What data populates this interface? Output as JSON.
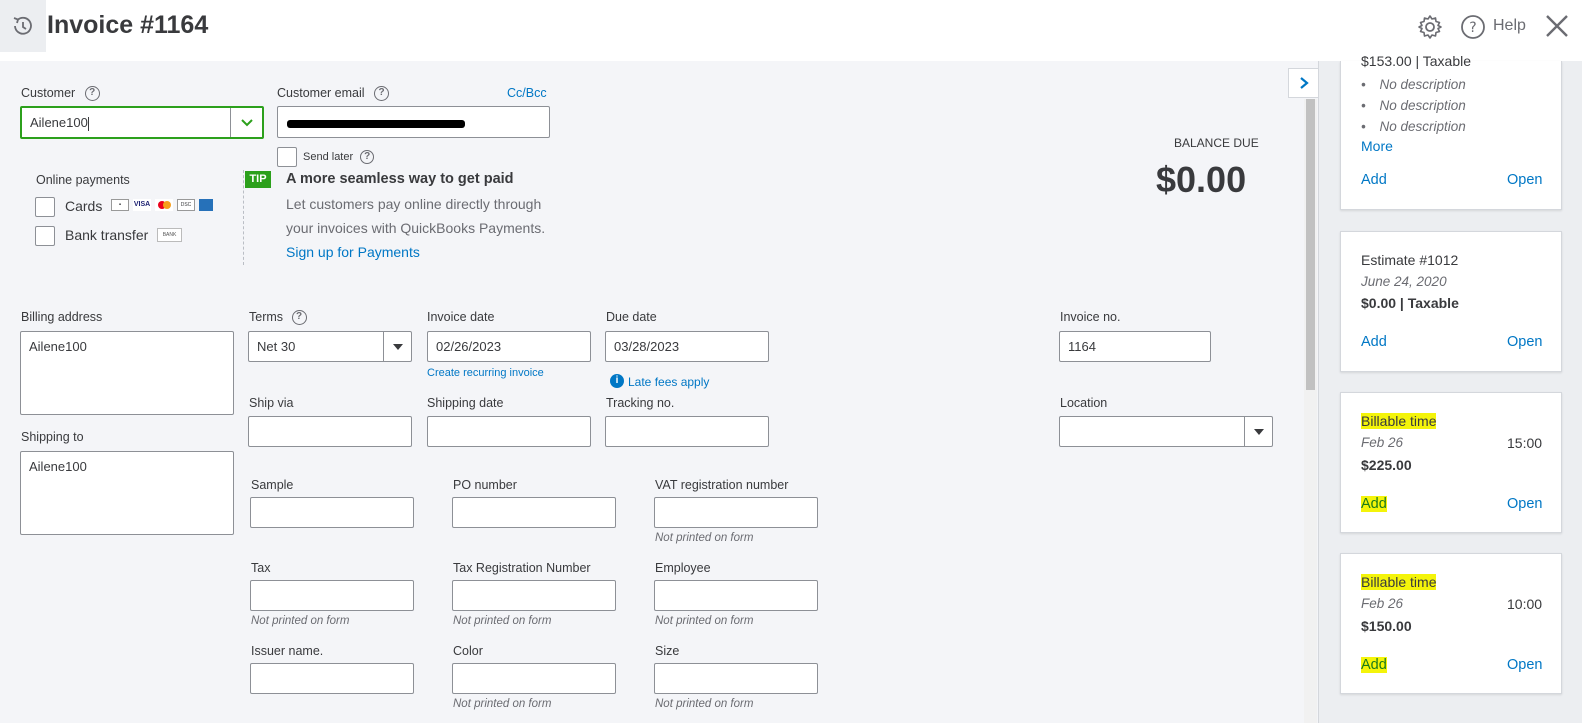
{
  "header": {
    "title": "Invoice #1164",
    "help_label": "Help"
  },
  "customer": {
    "label": "Customer",
    "value": "Ailene100"
  },
  "email": {
    "label": "Customer email",
    "cc_bcc": "Cc/Bcc",
    "send_later": "Send later"
  },
  "online_payments": {
    "label": "Online payments",
    "cards": "Cards",
    "bank_transfer": "Bank transfer",
    "bank_badge": "BANK"
  },
  "tip": {
    "badge": "TIP",
    "headline": "A more seamless way to get paid",
    "line1": "Let customers pay online directly through",
    "line2": "your invoices with QuickBooks Payments.",
    "link": "Sign up for Payments"
  },
  "balance": {
    "label": "BALANCE DUE",
    "amount": "$0.00"
  },
  "billing": {
    "label": "Billing address",
    "value": "Ailene100"
  },
  "shipping_to": {
    "label": "Shipping to",
    "value": "Ailene100"
  },
  "terms": {
    "label": "Terms",
    "value": "Net 30"
  },
  "invoice_date": {
    "label": "Invoice date",
    "value": "02/26/2023",
    "recurring": "Create recurring invoice"
  },
  "due_date": {
    "label": "Due date",
    "value": "03/28/2023",
    "late_fees": "Late fees apply"
  },
  "invoice_no": {
    "label": "Invoice no.",
    "value": "1164"
  },
  "ship_via": {
    "label": "Ship via"
  },
  "shipping_date": {
    "label": "Shipping date"
  },
  "tracking": {
    "label": "Tracking no."
  },
  "location": {
    "label": "Location"
  },
  "custom_fields": {
    "sample": "Sample",
    "po_number": "PO number",
    "vat": "VAT registration number",
    "tax": "Tax",
    "tax_reg": "Tax Registration Number",
    "employee": "Employee",
    "issuer": "Issuer name.",
    "color": "Color",
    "size": "Size",
    "not_printed": "Not printed on form"
  },
  "panel": {
    "card1": {
      "amount_line": "$153.00 | Taxable",
      "items": [
        "No description",
        "No description",
        "No description"
      ],
      "more": "More",
      "add": "Add",
      "open": "Open"
    },
    "card2": {
      "title": "Estimate #1012",
      "date": "June 24, 2020",
      "amount": "$0.00",
      "taxable": "Taxable",
      "add": "Add",
      "open": "Open"
    },
    "card3": {
      "title": "Billable time",
      "date": "Feb 26",
      "time": "15:00",
      "amount": "$225.00",
      "add": "Add",
      "open": "Open"
    },
    "card4": {
      "title": "Billable time",
      "date": "Feb 26",
      "time": "10:00",
      "amount": "$150.00",
      "add": "Add",
      "open": "Open"
    }
  },
  "icons": [
    "history-icon",
    "gear-icon",
    "help-icon",
    "close-icon",
    "chevron-down-icon",
    "chevron-right-icon",
    "info-icon",
    "question-icon"
  ],
  "colors": {
    "accent": "#0077c5",
    "focus_green": "#2ca01c",
    "tip_green": "#2ca01c",
    "highlight": "#f4f40a"
  }
}
